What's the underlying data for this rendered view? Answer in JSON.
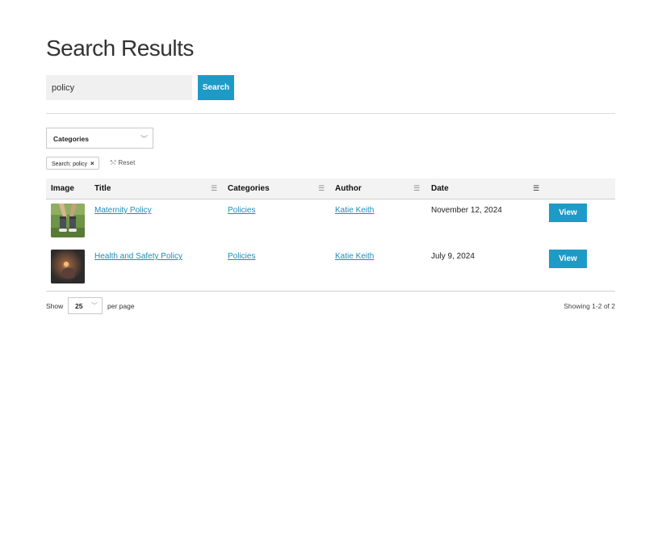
{
  "page": {
    "title": "Search Results"
  },
  "search": {
    "value": "policy",
    "button_label": "Search"
  },
  "filters": {
    "category_select": {
      "selected": "Categories"
    },
    "active_chip": {
      "label": "Search: policy",
      "remove": "×"
    },
    "reset_label": "Reset"
  },
  "table": {
    "headers": {
      "image": "Image",
      "title": "Title",
      "categories": "Categories",
      "author": "Author",
      "date": "Date"
    },
    "rows": [
      {
        "title": "Maternity Policy",
        "category": "Policies",
        "author": "Katie Keith",
        "date": "November 12, 2024",
        "action": "View",
        "image": "baby-shoes-photo"
      },
      {
        "title": "Health and Safety Policy",
        "category": "Policies",
        "author": "Katie Keith",
        "date": "July 9, 2024",
        "action": "View",
        "image": "dark-lantern-photo"
      }
    ]
  },
  "pagination": {
    "show_label": "Show",
    "per_page": "25",
    "per_page_label": "per page",
    "showing": "Showing 1-2 of 2"
  },
  "colors": {
    "accent": "#1d9bc6",
    "link": "#1a8fb8",
    "header_bg": "#f3f3f3"
  },
  "icons": {
    "sort": "filter-lines-icon",
    "chevron": "chevron-down-icon",
    "reset": "reset-icon",
    "close": "close-icon"
  }
}
